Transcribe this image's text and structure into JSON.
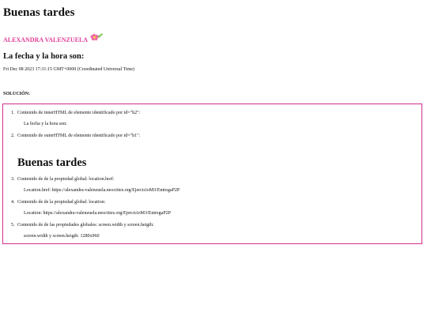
{
  "header": {
    "greeting": "Buenas tardes",
    "author": "ALEXANDRA VALENZUELA",
    "date_heading": "La fecha y la hora son:",
    "date_value": "Fri Dec 08 2023 17:31:15 GMT+0000 (Coordinated Universal Time)"
  },
  "solution": {
    "label": "SOLUCIÓN:",
    "items": [
      {
        "number": "1.",
        "text": "Contenido de innerHTML de elemento identificado por id=\"h2\":",
        "result": "La fecha y la hora son:"
      },
      {
        "number": "2.",
        "text": "Contenido de outerHTML de elemento identificado por id=\"h1\":",
        "result": "Buenas tardes"
      },
      {
        "number": "3.",
        "text": "Contenido de de la propiedad global: location.href:",
        "result": "Location.href: https://alexandra-valenzuela.neocities.org/EjercicioM3/EntregaP2P"
      },
      {
        "number": "4.",
        "text": "Contenido de de la propiedad global: location:",
        "result": "Location: https://alexandra-valenzuela.neocities.org/EjercicioM3/EntregaP2P"
      },
      {
        "number": "5.",
        "text": "Contenido de de las propiedades globales: screen.width y screen.heigth:",
        "result": "screen.width y screen.heigth: 1280x960"
      }
    ]
  },
  "colors": {
    "accent": "#e0409b",
    "box_border": "#d12d8f"
  },
  "icons": {
    "author_decoration": "flower-icon"
  }
}
